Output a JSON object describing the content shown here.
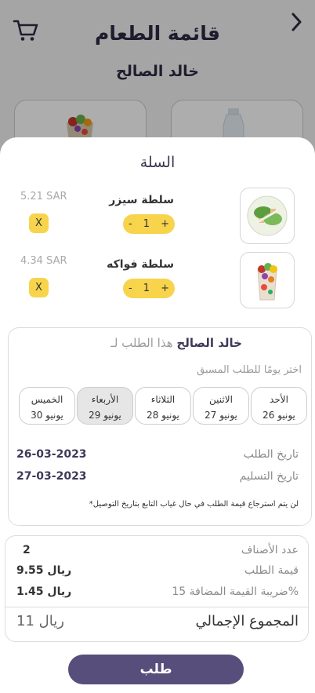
{
  "background": {
    "title": "قائمة الطعام",
    "subtitle": "خالد الصالح"
  },
  "cart": {
    "title": "السلة",
    "items": [
      {
        "name": "سلطة سيزر",
        "price": "5.21 SAR",
        "qty": "1",
        "plus": "+",
        "minus": "-",
        "remove": "X",
        "icon": "caesar-salad-image"
      },
      {
        "name": "سلطة فواكه",
        "price": "4.34 SAR",
        "qty": "1",
        "plus": "+",
        "minus": "-",
        "remove": "X",
        "icon": "fruit-salad-image"
      }
    ]
  },
  "order": {
    "for_label": "هذا الطلب لـ",
    "for_name": "خالد الصالح",
    "pick_day": "اختر يومًا للطلب المسبق",
    "days": [
      {
        "name": "الأحد",
        "date": "26 يونيو"
      },
      {
        "name": "الاثنين",
        "date": "27 يونيو"
      },
      {
        "name": "الثلاثاء",
        "date": "28 يونيو"
      },
      {
        "name": "الأربعاء",
        "date": "29 يونيو",
        "selected": true
      },
      {
        "name": "الخميس",
        "date": "30 يونيو"
      }
    ],
    "order_date_label": "تاريخ الطلب",
    "order_date": "26-03-2023",
    "delivery_date_label": "تاريخ التسليم",
    "delivery_date": "27-03-2023",
    "note": "*لن يتم استرجاع قيمة الطلب في حال غياب التابع بتاريخ التوصيل"
  },
  "summary": {
    "items_count_label": "عدد الأصناف",
    "items_count": "2",
    "order_value_label": "قيمة الطلب",
    "order_value": "9.55 ريال",
    "vat_label": "ضريبة القيمة المضافة 15%",
    "vat": "1.45 ريال",
    "total_label": "المجموع الإجمالي",
    "total": "11 ريال"
  },
  "submit_label": "طلب",
  "colors": {
    "accent": "#574e7c",
    "yellow": "#f7d44c"
  }
}
